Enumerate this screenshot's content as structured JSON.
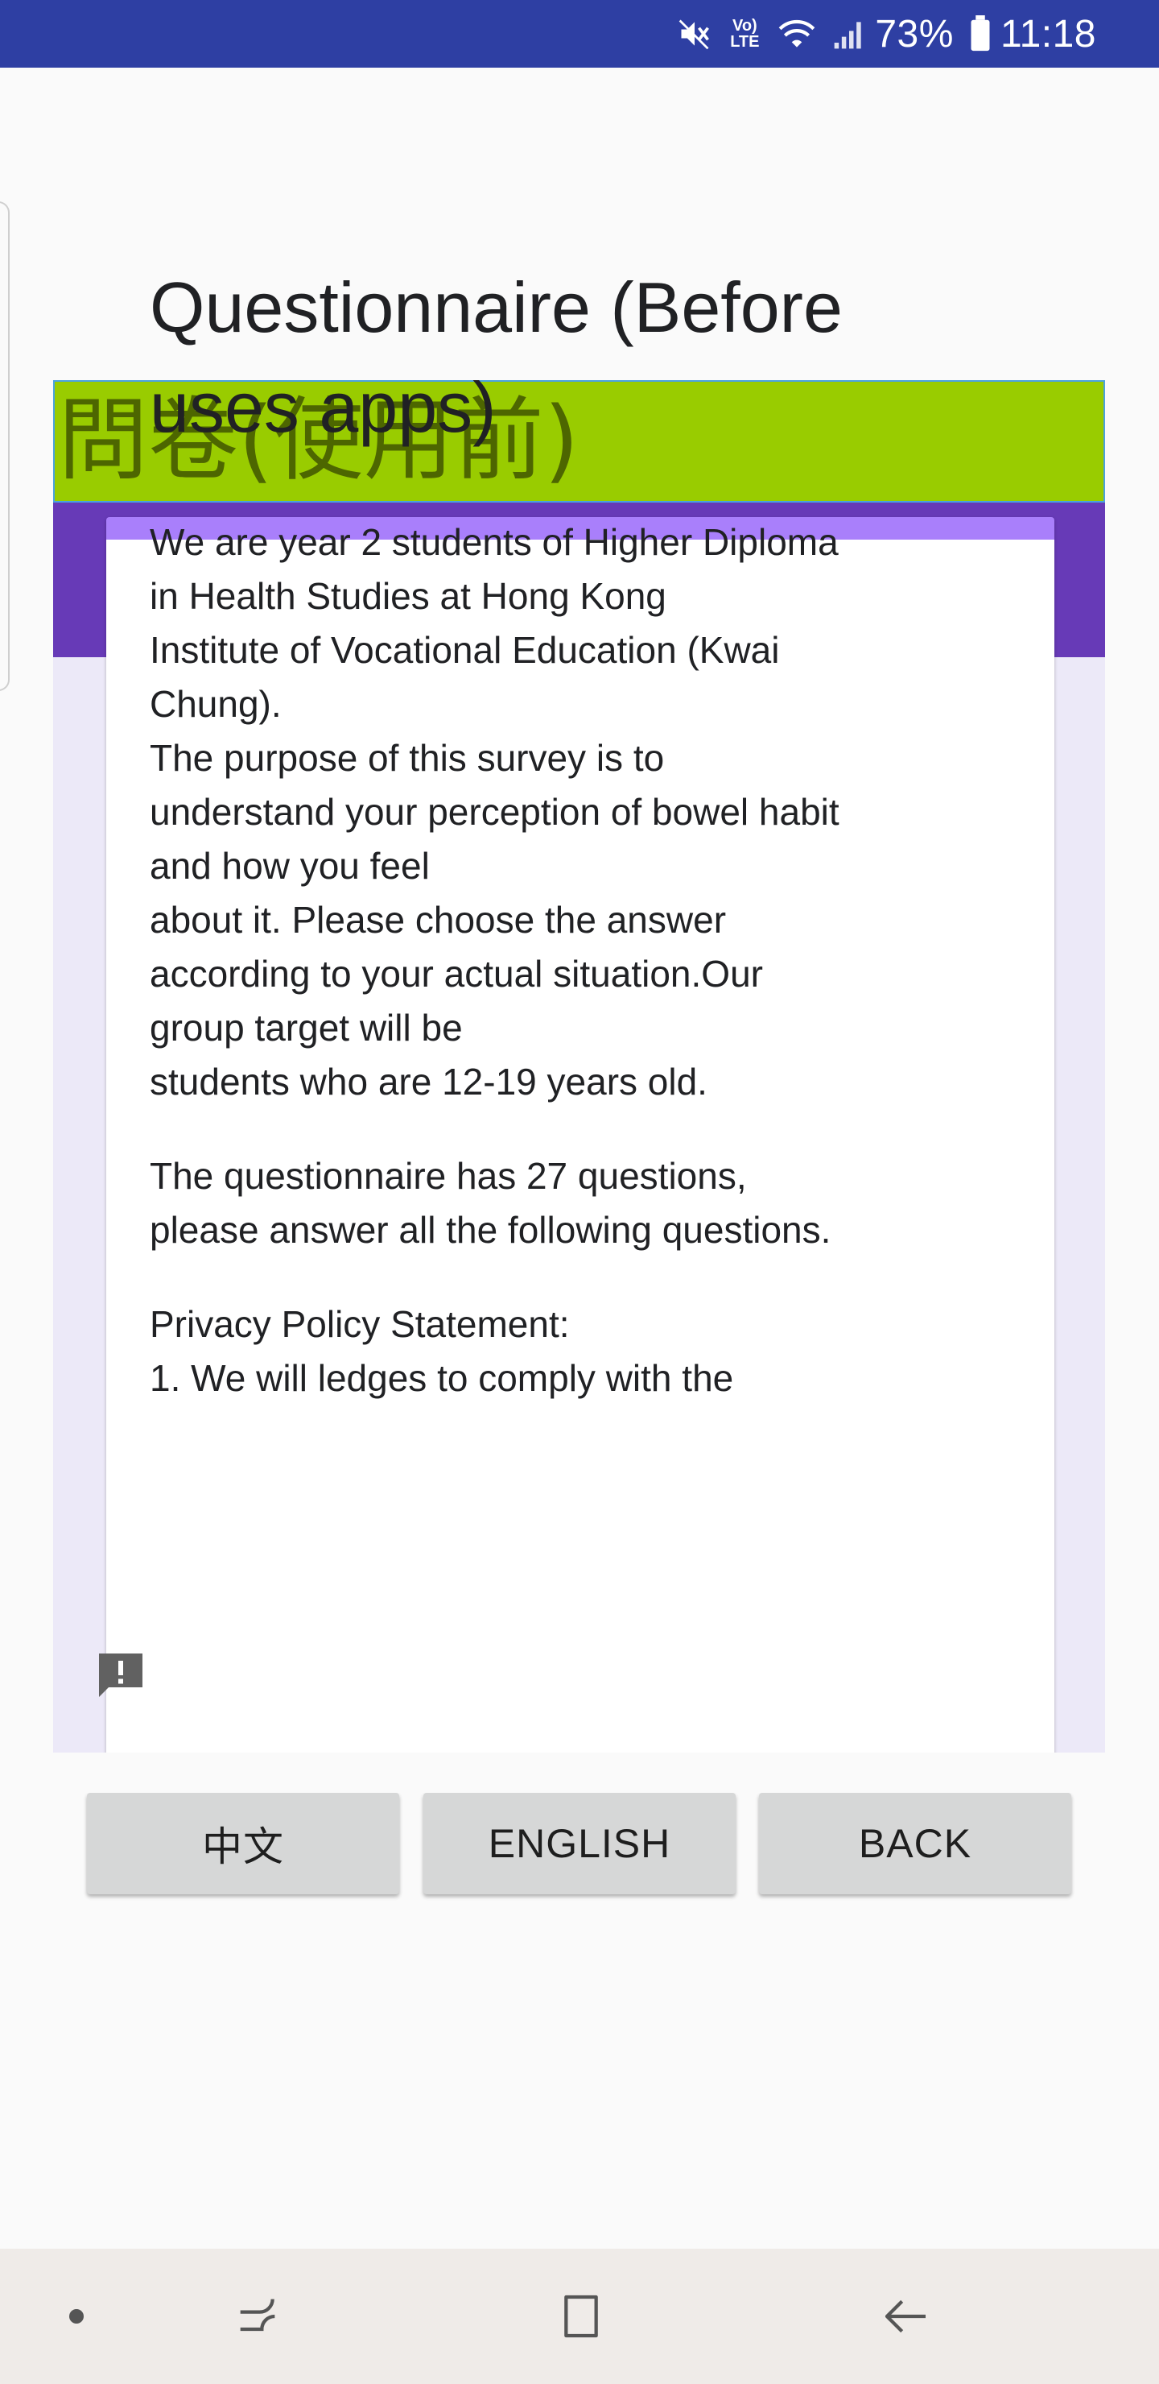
{
  "status_bar": {
    "battery_percent": "73%",
    "time": "11:18",
    "volte_label": "Vo) LTE",
    "icons": [
      "mute-icon",
      "volte-icon",
      "wifi-icon",
      "signal-icon",
      "battery-icon"
    ]
  },
  "banner": {
    "title": "問卷(使用前)",
    "background_color": "#99cc00",
    "text_color": "#4d6600"
  },
  "form": {
    "title": "Questionnaire (Before uses apps)",
    "description_lines": [
      "We are year 2 students of Higher Diploma",
      "in Health Studies at Hong Kong",
      "Institute of Vocational Education (Kwai",
      "Chung).",
      "The purpose of this survey is to",
      "understand your perception of bowel habit",
      "and how you feel",
      "about it. Please choose the answer",
      "according to your actual situation.Our",
      "group target will be",
      "students who are 12-19 years old."
    ],
    "questions_note_lines": [
      "The questionnaire has 27 questions,",
      "please answer all the following questions."
    ],
    "privacy_heading": "Privacy Policy Statement:",
    "privacy_first_line_partial": "1. We will ledges to comply with the",
    "accent_color": "#673ab7",
    "card_accent_color": "#a97ffb"
  },
  "buttons": {
    "chinese": "中文",
    "english": "ENGLISH",
    "back": "BACK"
  },
  "nav_bar": {
    "icons": [
      "nav-dot-icon",
      "recent-apps-icon",
      "home-icon",
      "back-icon"
    ]
  }
}
